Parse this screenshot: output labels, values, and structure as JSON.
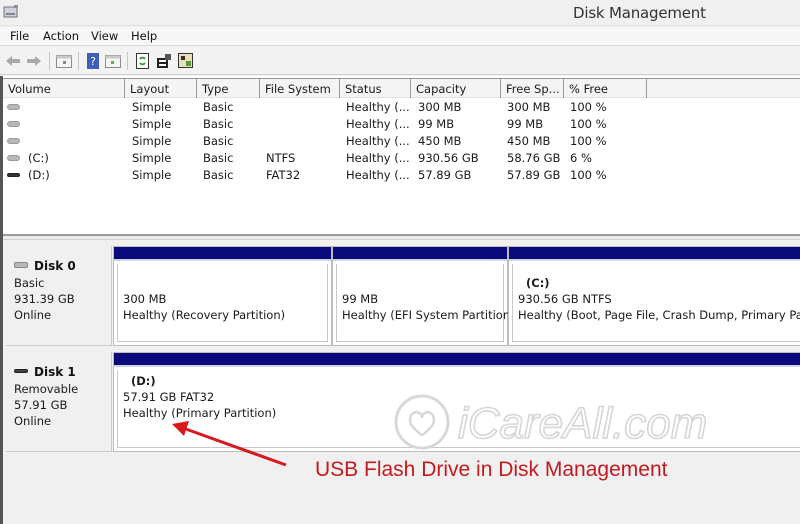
{
  "window": {
    "title": "Disk Management",
    "app_icon": "disk-management-icon"
  },
  "menu": {
    "items": [
      "File",
      "Action",
      "View",
      "Help"
    ]
  },
  "toolbar": {
    "buttons": [
      {
        "name": "back-icon",
        "tooltip": "Back"
      },
      {
        "name": "forward-icon",
        "tooltip": "Forward"
      },
      {
        "name": "show-hide-console-tree-icon",
        "tooltip": "Show/Hide Console Tree"
      },
      {
        "name": "help-icon",
        "tooltip": "Help"
      },
      {
        "name": "show-hide-action-pane-icon",
        "tooltip": "Show/Hide Action Pane"
      },
      {
        "name": "refresh-icon",
        "tooltip": "Refresh"
      },
      {
        "name": "properties-icon",
        "tooltip": "Properties"
      },
      {
        "name": "rescan-disks-icon",
        "tooltip": "Rescan Disks"
      }
    ]
  },
  "volume_list": {
    "columns": [
      "Volume",
      "Layout",
      "Type",
      "File System",
      "Status",
      "Capacity",
      "Free Sp...",
      "% Free"
    ],
    "rows": [
      {
        "volume": "",
        "layout": "Simple",
        "type": "Basic",
        "fs": "",
        "status": "Healthy (...",
        "capacity": "300 MB",
        "free": "300 MB",
        "pct": "100 %",
        "icon": "disk"
      },
      {
        "volume": "",
        "layout": "Simple",
        "type": "Basic",
        "fs": "",
        "status": "Healthy (...",
        "capacity": "99 MB",
        "free": "99 MB",
        "pct": "100 %",
        "icon": "disk"
      },
      {
        "volume": "",
        "layout": "Simple",
        "type": "Basic",
        "fs": "",
        "status": "Healthy (...",
        "capacity": "450 MB",
        "free": "450 MB",
        "pct": "100 %",
        "icon": "disk"
      },
      {
        "volume": "(C:)",
        "layout": "Simple",
        "type": "Basic",
        "fs": "NTFS",
        "status": "Healthy (...",
        "capacity": "930.56 GB",
        "free": "58.76 GB",
        "pct": "6 %",
        "icon": "disk"
      },
      {
        "volume": "(D:)",
        "layout": "Simple",
        "type": "Basic",
        "fs": "FAT32",
        "status": "Healthy (...",
        "capacity": "57.89 GB",
        "free": "57.89 GB",
        "pct": "100 %",
        "icon": "usb"
      }
    ]
  },
  "disks": [
    {
      "name": "Disk 0",
      "type": "Basic",
      "size": "931.39 GB",
      "state": "Online",
      "partitions": [
        {
          "drive": "",
          "size": "300 MB",
          "status": "Healthy (Recovery Partition)"
        },
        {
          "drive": "",
          "size": "99 MB",
          "status": "Healthy (EFI System Partition)"
        },
        {
          "drive": "(C:)",
          "size": "930.56 GB NTFS",
          "status": "Healthy (Boot, Page File, Crash Dump, Primary Partitio"
        }
      ]
    },
    {
      "name": "Disk 1",
      "type": "Removable",
      "size": "57.91 GB",
      "state": "Online",
      "partitions": [
        {
          "drive": "(D:)",
          "size": "57.91 GB FAT32",
          "status": "Healthy (Primary Partition)"
        }
      ]
    }
  ],
  "annotation": {
    "text": "USB Flash  Drive in Disk Management",
    "color": "#c41a1f"
  },
  "watermark": {
    "text": "iCareAll.com"
  },
  "colors": {
    "partition_bar": "#0a0a7a",
    "window_bg": "#f0f0f0"
  }
}
